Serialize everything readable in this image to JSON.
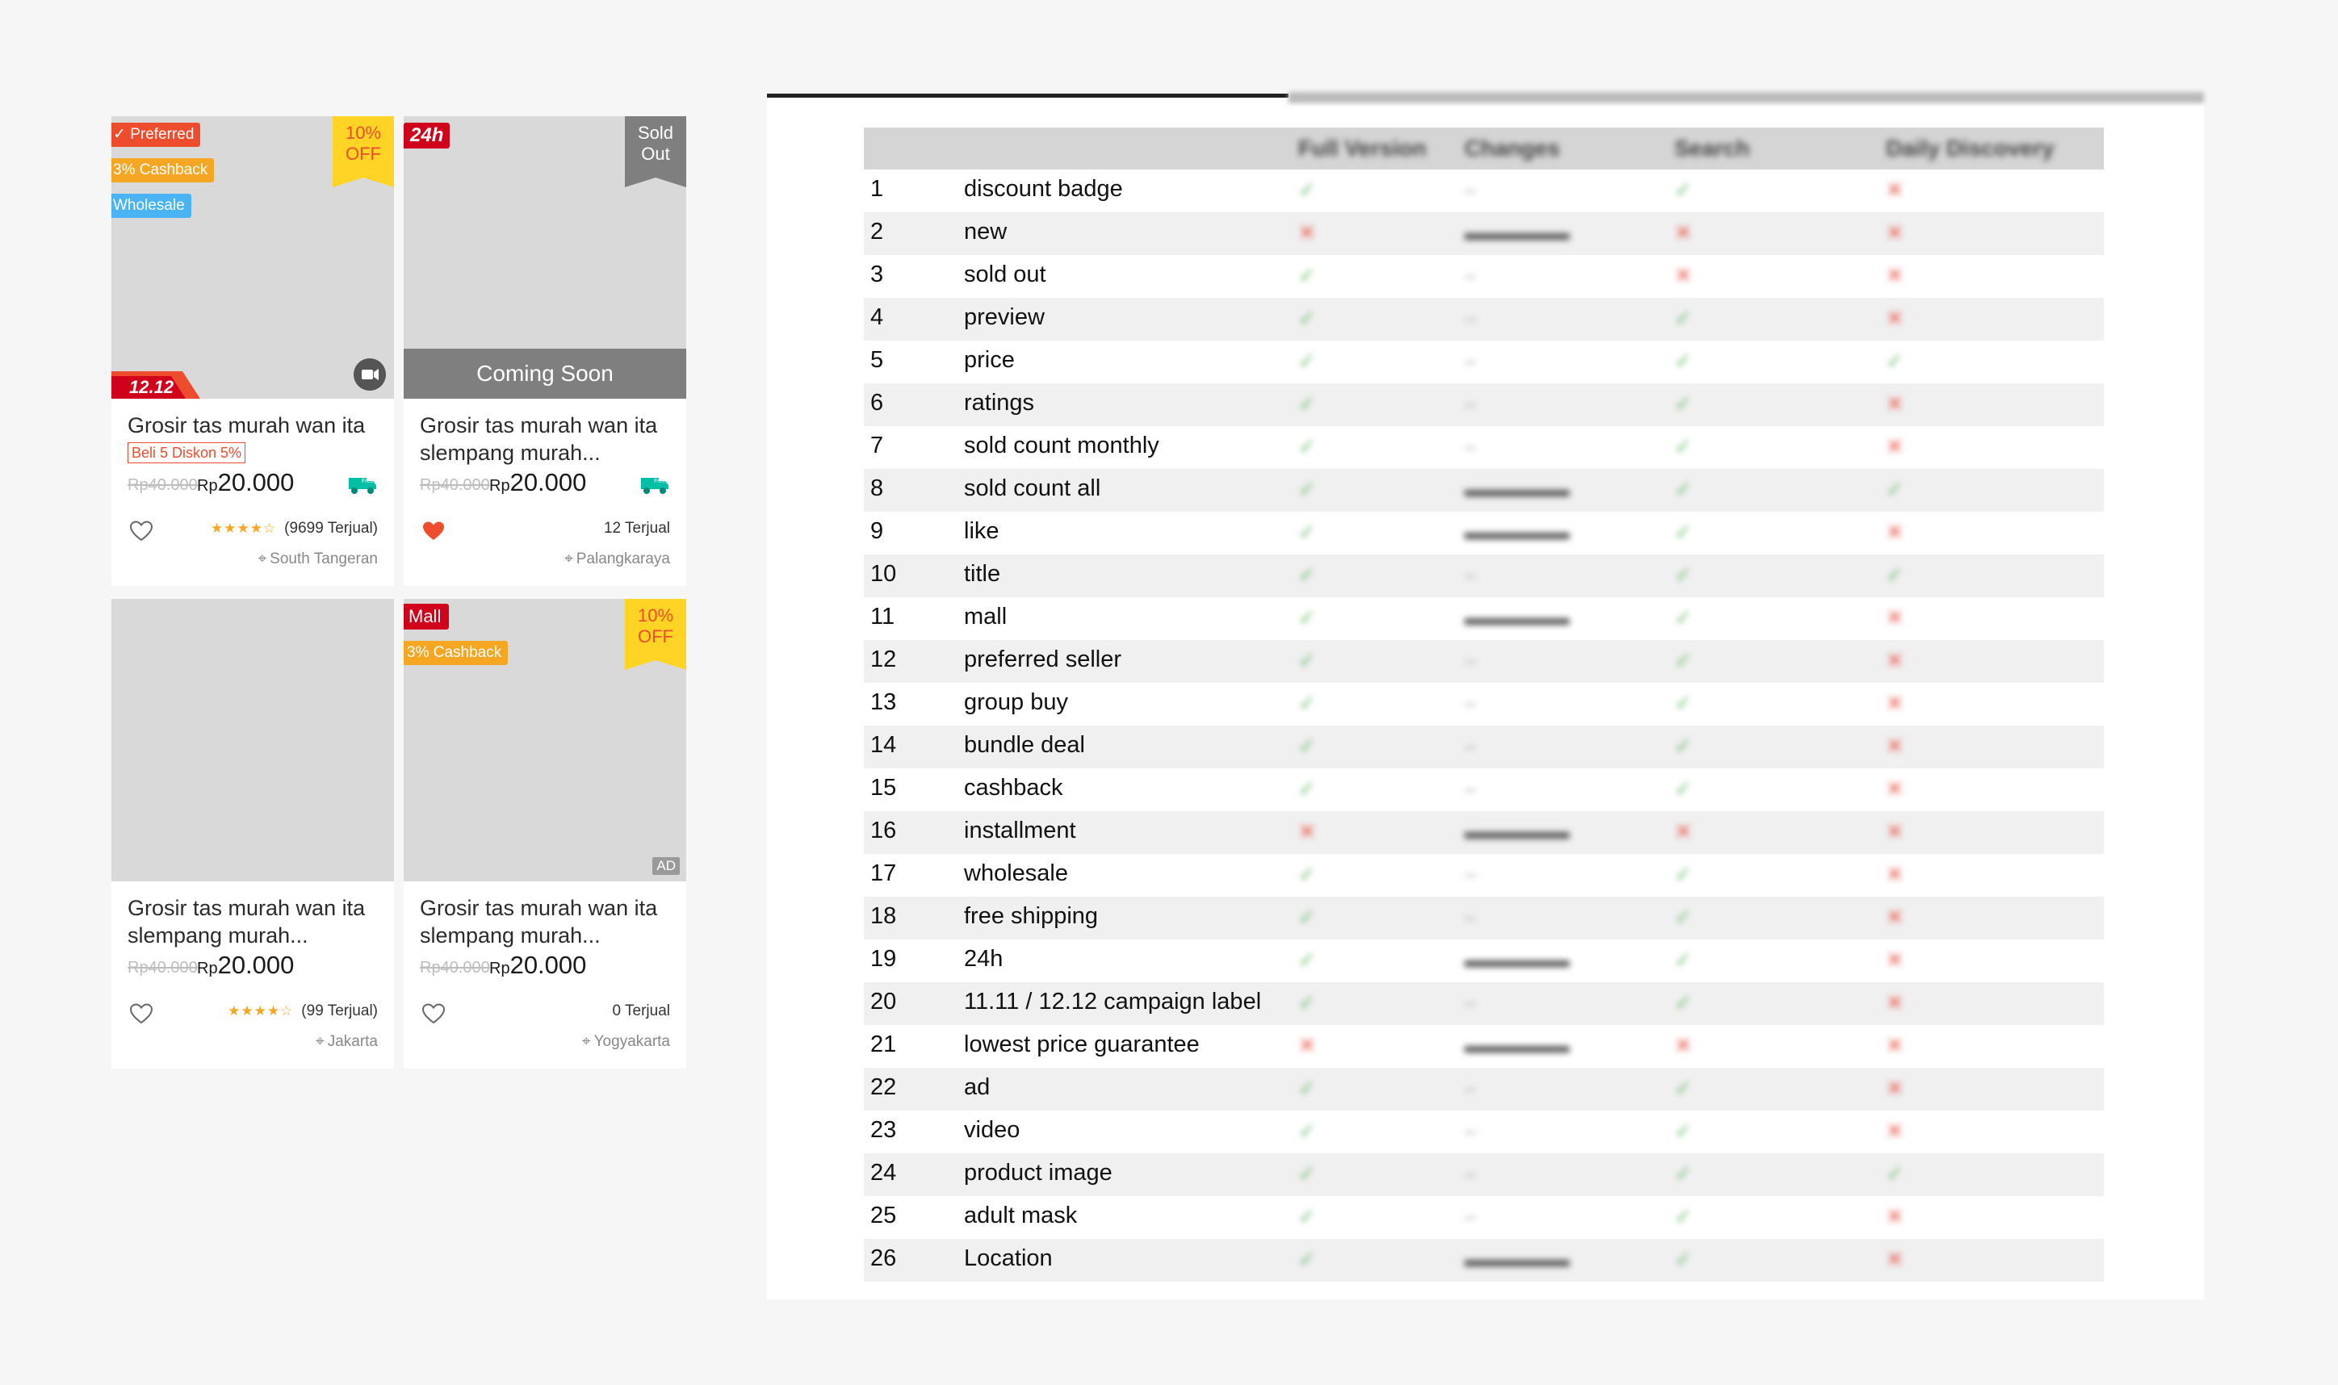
{
  "cards": [
    {
      "badges": {
        "preferred": "Preferred",
        "cashback": "3% Cashback",
        "wholesale": "Wholesale"
      },
      "discount": {
        "pct": "10%",
        "off": "OFF"
      },
      "campaign": "12.12",
      "promo": "Beli 5 Diskon 5%",
      "title": "Grosir tas murah wan ita",
      "orig_price": "Rp40.000",
      "price_prefix": "Rp",
      "price": "20.000",
      "ship_label": "Free",
      "stars": "★★★★☆",
      "sold": "(9699 Terjual)",
      "location": "South Tangeran"
    },
    {
      "badges": {
        "h24": "24h"
      },
      "sold_out": {
        "line1": "Sold",
        "line2": "Out"
      },
      "coming_soon": "Coming Soon",
      "title": "Grosir tas murah wan ita slempang murah...",
      "orig_price": "Rp40.000",
      "price_prefix": "Rp",
      "price": "20.000",
      "ship_label": "Free",
      "sold": "12 Terjual",
      "location": "Palangkaraya"
    },
    {
      "title": "Grosir tas murah wan ita slempang murah...",
      "orig_price": "Rp40.000",
      "price_prefix": "Rp",
      "price": "20.000",
      "stars": "★★★★☆",
      "sold": "(99 Terjual)",
      "location": "Jakarta"
    },
    {
      "badges": {
        "mall": "Mall",
        "cashback": "3% Cashback"
      },
      "discount": {
        "pct": "10%",
        "off": "OFF"
      },
      "ad": "AD",
      "title": "Grosir tas murah wan ita slempang murah...",
      "orig_price": "Rp40.000",
      "price_prefix": "Rp",
      "price": "20.000",
      "sold": "0 Terjual",
      "location": "Yogyakarta"
    }
  ],
  "table": {
    "headers": [
      "Full Version",
      "Changes",
      "Search",
      "Daily Discovery"
    ],
    "rows": [
      {
        "n": "1",
        "feature": "discount badge"
      },
      {
        "n": "2",
        "feature": "new"
      },
      {
        "n": "3",
        "feature": "sold out"
      },
      {
        "n": "4",
        "feature": "preview"
      },
      {
        "n": "5",
        "feature": "price"
      },
      {
        "n": "6",
        "feature": "ratings"
      },
      {
        "n": "7",
        "feature": "sold count monthly"
      },
      {
        "n": "8",
        "feature": "sold count all"
      },
      {
        "n": "9",
        "feature": "like"
      },
      {
        "n": "10",
        "feature": "title"
      },
      {
        "n": "11",
        "feature": "mall"
      },
      {
        "n": "12",
        "feature": "preferred seller"
      },
      {
        "n": "13",
        "feature": "group buy"
      },
      {
        "n": "14",
        "feature": "bundle deal"
      },
      {
        "n": "15",
        "feature": "cashback"
      },
      {
        "n": "16",
        "feature": "installment"
      },
      {
        "n": "17",
        "feature": "wholesale"
      },
      {
        "n": "18",
        "feature": "free shipping"
      },
      {
        "n": "19",
        "feature": "24h"
      },
      {
        "n": "20",
        "feature": "11.11 / 12.12 campaign label"
      },
      {
        "n": "21",
        "feature": "lowest price guarantee"
      },
      {
        "n": "22",
        "feature": "ad"
      },
      {
        "n": "23",
        "feature": "video"
      },
      {
        "n": "24",
        "feature": "product image"
      },
      {
        "n": "25",
        "feature": "adult mask"
      },
      {
        "n": "26",
        "feature": "Location"
      }
    ]
  },
  "colors": {
    "accent": "#ee4d2d",
    "yellow": "#ffd424",
    "mall": "#d0011b",
    "check": "#5cb85c",
    "cross": "#e74c3c"
  }
}
